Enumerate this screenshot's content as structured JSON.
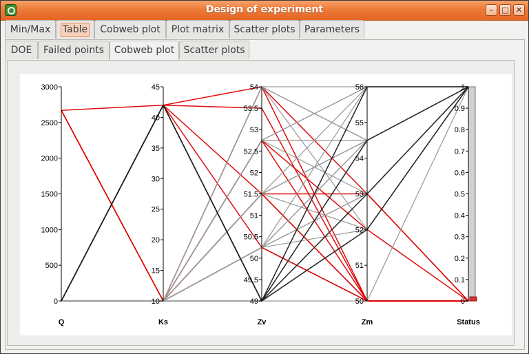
{
  "window": {
    "title": "Design of experiment",
    "buttons": [
      "minimize",
      "maximize",
      "close"
    ],
    "accent_color": "#ee7a38"
  },
  "tabs_top": [
    {
      "label": "Min/Max",
      "active": false
    },
    {
      "label": "Table",
      "active": true
    },
    {
      "label": "Cobweb plot",
      "active": false
    },
    {
      "label": "Plot matrix",
      "active": false
    },
    {
      "label": "Scatter plots",
      "active": false
    },
    {
      "label": "Parameters",
      "active": false
    }
  ],
  "tabs_sub": [
    {
      "label": "DOE",
      "active": false
    },
    {
      "label": "Failed points",
      "active": false
    },
    {
      "label": "Cobweb plot",
      "active": true
    },
    {
      "label": "Scatter plots",
      "active": false
    }
  ],
  "chart_data": {
    "type": "parallel-coordinates",
    "axes": [
      {
        "name": "Q",
        "range": [
          0,
          3000
        ],
        "ticks": [
          "0",
          "500",
          "1000",
          "1500",
          "2000",
          "2500",
          "3000"
        ]
      },
      {
        "name": "Ks",
        "range": [
          10,
          45
        ],
        "ticks": [
          "10",
          "15",
          "20",
          "25",
          "30",
          "35",
          "40",
          "45"
        ]
      },
      {
        "name": "Zv",
        "range": [
          49,
          54
        ],
        "ticks": [
          "49",
          "49.5",
          "50",
          "50.5",
          "51",
          "51.5",
          "52",
          "52.5",
          "53",
          "53.5",
          "54"
        ]
      },
      {
        "name": "Zm",
        "range": [
          50,
          56
        ],
        "ticks": [
          "50",
          "51",
          "52",
          "53",
          "54",
          "55",
          "56"
        ]
      },
      {
        "name": "Status",
        "range": [
          0,
          1
        ],
        "ticks": [
          "0",
          "0.1",
          "0.2",
          "0.3",
          "0.4",
          "0.5",
          "0.6",
          "0.7",
          "0.8",
          "0.9",
          "1"
        ]
      }
    ],
    "series": [
      {
        "color": "#dd0000",
        "lines": [
          [
            0,
            10,
            54,
            50,
            0
          ],
          [
            2670,
            42,
            54,
            53,
            0
          ],
          [
            2670,
            10,
            52.75,
            50,
            0
          ],
          [
            0,
            42,
            53.5,
            50,
            0
          ],
          [
            0,
            10,
            52.75,
            52,
            0
          ],
          [
            0,
            42,
            51.5,
            53,
            0
          ],
          [
            2670,
            10,
            50.25,
            50,
            0
          ],
          [
            0,
            10,
            51.5,
            50,
            0
          ],
          [
            0,
            42,
            50.25,
            50,
            0
          ],
          [
            2670,
            10,
            51.5,
            50,
            0
          ]
        ]
      },
      {
        "color": "#999999",
        "lines": [
          [
            0,
            10,
            49,
            56,
            1
          ],
          [
            0,
            10,
            49,
            54.5,
            1
          ],
          [
            0,
            10,
            49,
            53,
            1
          ],
          [
            0,
            10,
            49,
            52,
            1
          ],
          [
            0,
            10,
            50.25,
            56,
            1
          ],
          [
            0,
            10,
            50.25,
            54.5,
            1
          ],
          [
            0,
            10,
            50.25,
            53,
            1
          ],
          [
            0,
            10,
            50.25,
            52,
            1
          ],
          [
            0,
            10,
            51.5,
            56,
            1
          ],
          [
            0,
            10,
            51.5,
            54.5,
            1
          ],
          [
            0,
            10,
            51.5,
            52,
            1
          ],
          [
            0,
            10,
            52.75,
            56,
            1
          ],
          [
            0,
            10,
            52.75,
            54.5,
            1
          ],
          [
            0,
            10,
            52.75,
            53,
            1
          ],
          [
            0,
            10,
            54,
            56,
            1
          ],
          [
            0,
            10,
            54,
            54.5,
            1
          ],
          [
            0,
            10,
            54,
            52,
            1
          ],
          [
            0,
            10,
            49,
            50,
            1
          ],
          [
            0,
            10,
            50.25,
            54.5,
            1
          ],
          [
            0,
            10,
            52.75,
            56,
            1
          ],
          [
            0,
            10,
            54,
            54.5,
            1
          ],
          [
            0,
            10,
            49,
            52,
            1
          ],
          [
            0,
            10,
            51.5,
            54.5,
            1
          ],
          [
            0,
            10,
            50.25,
            53,
            1
          ]
        ]
      },
      {
        "color": "#222222",
        "lines": [
          [
            0,
            42,
            49,
            56,
            1
          ],
          [
            0,
            42,
            49,
            54.5,
            1
          ],
          [
            0,
            42,
            49,
            53,
            1
          ],
          [
            0,
            42,
            49,
            52,
            1
          ]
        ]
      }
    ],
    "status_bar": {
      "range": [
        0,
        1
      ],
      "fill_color": "#dd3333",
      "background_color": "#d0d0d0"
    }
  }
}
